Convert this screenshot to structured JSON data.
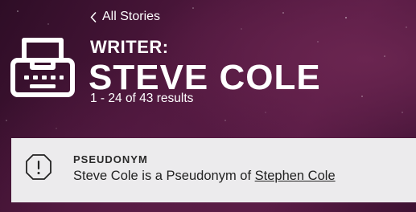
{
  "nav": {
    "back_label": "All Stories"
  },
  "header": {
    "role": "WRITER:",
    "name": "STEVE COLE",
    "results": "1 - 24 of 43 results"
  },
  "notice": {
    "title": "PSEUDONYM",
    "text_prefix": "Steve Cole is a Pseudonym of ",
    "link": "Stephen Cole"
  },
  "icons": {
    "back": "chevron-left-icon",
    "logo": "typewriter-icon",
    "notice": "alert-octagon-icon"
  },
  "colors": {
    "background": "#4d173c",
    "text": "#ffffff",
    "notice_background": "#ecebed"
  }
}
